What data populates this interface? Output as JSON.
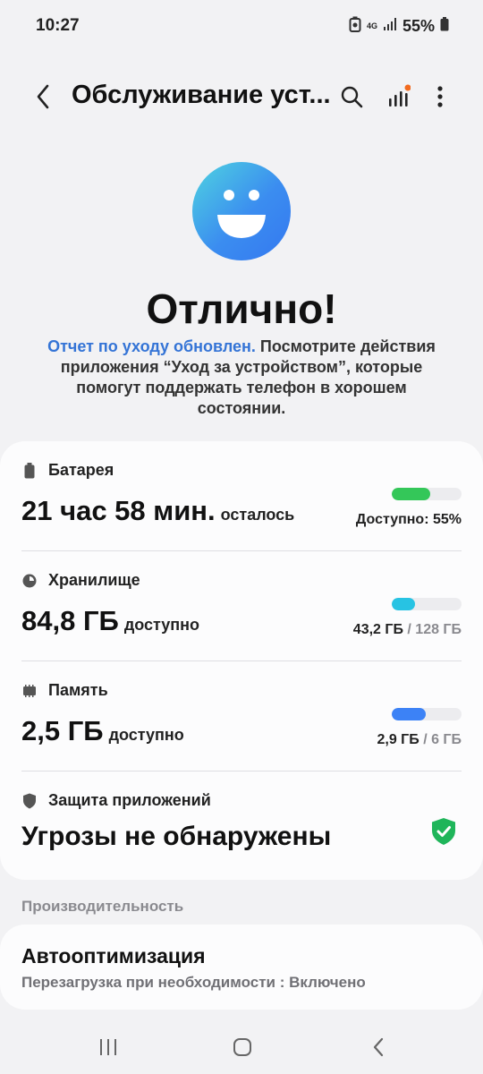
{
  "status_bar": {
    "time": "10:27",
    "network": "4G",
    "battery": "55%"
  },
  "app_bar": {
    "title": "Обслуживание уст...",
    "icons": [
      "back-icon",
      "search-icon",
      "diagnostics-icon",
      "more-options-icon"
    ],
    "notification_dot_color": "#f26b1f"
  },
  "hero": {
    "icon": "smiley-face-icon",
    "title": "Отлично!",
    "desc_link": "Отчет по уходу обновлен.",
    "desc_text": " Посмотрите действия приложения “Уход за устройством”, которые помогут поддержать телефон в хорошем состоянии."
  },
  "battery": {
    "label": "Батарея",
    "value": "21 час 58 мин.",
    "suffix": "осталось",
    "meta": "Доступно: 55%",
    "level": 0.55,
    "color": "#34c759"
  },
  "storage": {
    "label": "Хранилище",
    "value": "84,8 ГБ",
    "suffix": "доступно",
    "used": "43,2 ГБ",
    "total": " / 128 ГБ",
    "level": 0.3375,
    "color": "#27c3e3"
  },
  "memory": {
    "label": "Память",
    "value": "2,5 ГБ",
    "suffix": "доступно",
    "used": "2,9 ГБ",
    "total": " / 6 ГБ",
    "level": 0.483,
    "color": "#3c82f6"
  },
  "app_protection": {
    "label": "Защита приложений",
    "value": "Угрозы не обнаружены",
    "status_color": "#1fb55a"
  },
  "performance": {
    "section_label": "Производительность",
    "title": "Автооптимизация",
    "subtitle": "Перезагрузка при необходимости : Включено"
  },
  "nav": [
    "recents-icon",
    "home-icon",
    "back-nav-icon"
  ]
}
